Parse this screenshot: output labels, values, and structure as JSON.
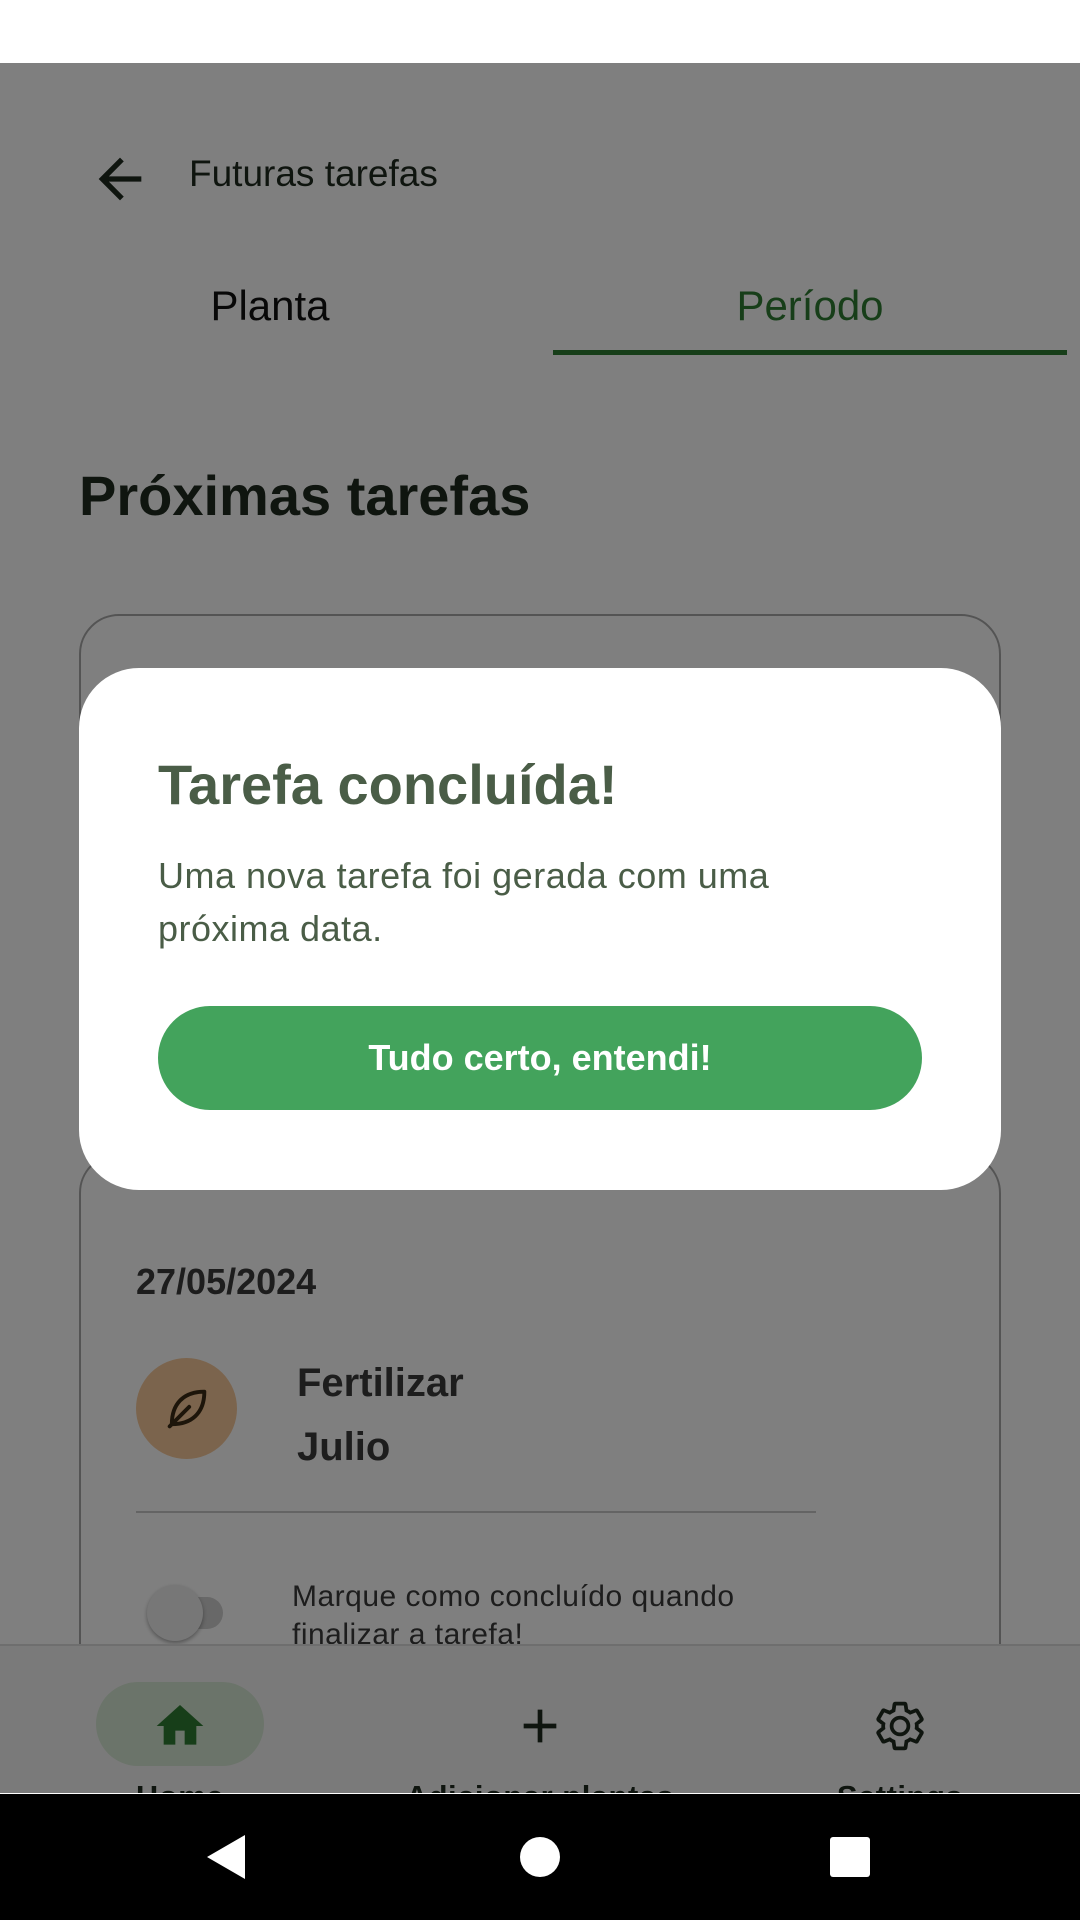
{
  "topbar": {
    "title": "Futuras tarefas"
  },
  "tabs": [
    {
      "label": "Planta",
      "selected": false
    },
    {
      "label": "Período",
      "selected": true
    }
  ],
  "section": {
    "title": "Próximas tarefas"
  },
  "task_card": {
    "date": "27/05/2024",
    "task": "Fertilizar",
    "plant": "Julio",
    "plant_icon": "leaf-icon",
    "toggle_hint": "Marque como concluído quando finalizar a tarefa!",
    "completed": false
  },
  "bottom_nav": [
    {
      "label": "Home",
      "icon": "home-icon",
      "active": true
    },
    {
      "label": "Adicionar plantas",
      "icon": "plus-icon",
      "active": false
    },
    {
      "label": "Settings",
      "icon": "gear-icon",
      "active": false
    }
  ],
  "dialog": {
    "title": "Tarefa concluída!",
    "message": "Uma nova tarefa foi gerada com uma próxima data.",
    "button_label": "Tudo certo, entendi!"
  },
  "colors": {
    "accent_green": "#2e7d32",
    "button_green": "#43a35c",
    "dialog_text": "#4a5d47",
    "avatar_bg": "#f6c99a"
  }
}
